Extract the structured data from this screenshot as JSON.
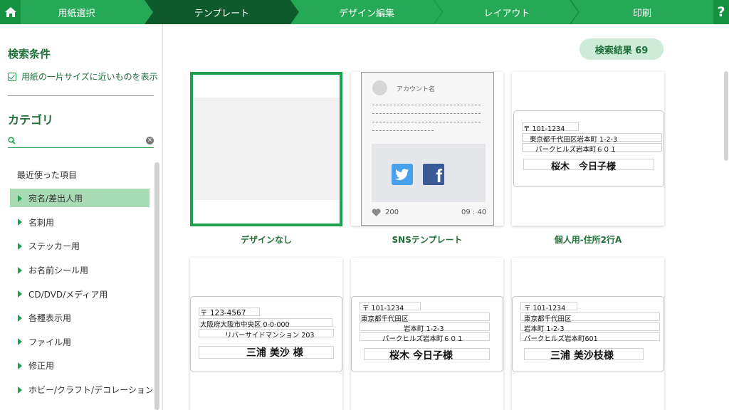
{
  "topbar": {
    "home_icon": "home-icon",
    "steps": [
      "用紙選択",
      "テンプレート",
      "デザイン編集",
      "レイアウト",
      "印刷"
    ],
    "active_step": "テンプレート",
    "help_label": "?",
    "colors": {
      "bar": "#1fa04e",
      "active": "#0e5a2b"
    }
  },
  "sidebar": {
    "search_title": "検索条件",
    "condition_label": "用紙の一片サイズに近いものを表示",
    "category_title": "カテゴリ",
    "search_value": "",
    "recent_label": "最近使った項目",
    "categories": [
      "宛名/差出人用",
      "名刺用",
      "ステッカー用",
      "お名前シール用",
      "CD/DVD/メディア用",
      "各種表示用",
      "ファイル用",
      "修正用",
      "ホビー/クラフト/デコレーション用"
    ],
    "selected_category": "宛名/差出人用"
  },
  "main": {
    "result_count_label": "検索結果 69",
    "templates": [
      {
        "label": "デザインなし"
      },
      {
        "label": "SNSテンプレート",
        "account": "アカウント名",
        "likes": "200",
        "time": "09 : 40"
      },
      {
        "label": "個人用-住所2行A",
        "postal": "〒 101-1234",
        "line1": "東京都千代田区岩本町 1-2-3",
        "line2": "パークヒルズ岩本町６０１",
        "name": "桜木　今日子様"
      },
      {
        "postal": "〒 123-4567",
        "line1": "大阪府大阪市中央区 0-0-000",
        "line2": "リバーサイドマンション 203",
        "name": "三浦 美沙 様"
      },
      {
        "postal": "〒 101-1234",
        "line1": "東京都千代田区",
        "line2": "岩本町 1-2-3",
        "line3": "パークヒルズ岩本町６０１",
        "name": "桜木 今日子様"
      },
      {
        "postal": "〒 101-1234",
        "line1": "東京都千代田区",
        "line2": "岩本町 1-2-3",
        "line3": "パークヒルズ岩本町601",
        "name": "三浦 美沙枝様"
      }
    ]
  }
}
